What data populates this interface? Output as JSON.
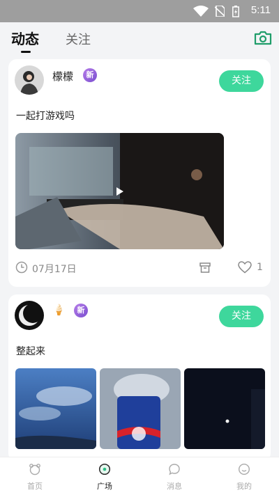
{
  "status_bar": {
    "time": "5:11"
  },
  "header": {
    "tabs": [
      {
        "label": "动态",
        "active": true
      },
      {
        "label": "关注",
        "active": false
      }
    ],
    "camera_icon": "camera-icon"
  },
  "posts": [
    {
      "username": "檬檬",
      "badge": "新",
      "follow_label": "关注",
      "text": "一起打游戏吗",
      "media": "video",
      "date": "07月17日",
      "likes": "1"
    },
    {
      "username": "",
      "emoji": "🍦",
      "badge": "新",
      "follow_label": "关注",
      "text": "整起来",
      "media": "images"
    }
  ],
  "bottom_nav": [
    {
      "label": "首页",
      "icon": "home-icon",
      "active": false
    },
    {
      "label": "广场",
      "icon": "square-icon",
      "active": true
    },
    {
      "label": "消息",
      "icon": "message-icon",
      "active": false
    },
    {
      "label": "我的",
      "icon": "profile-icon",
      "active": false
    }
  ],
  "colors": {
    "accent": "#3ed79c",
    "badge": "#9b63e0",
    "active_nav": "#2fbf86"
  }
}
